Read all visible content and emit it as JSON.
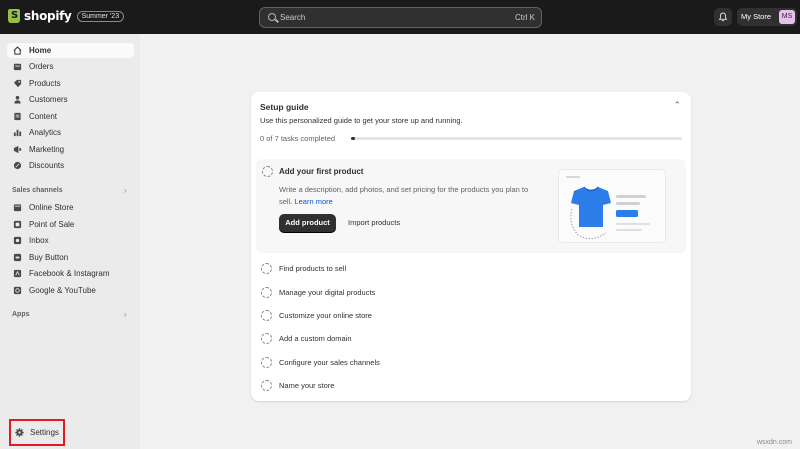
{
  "topbar": {
    "brand": "shopify",
    "edition": "Summer '23",
    "search_placeholder": "Search",
    "search_shortcut": "Ctrl K",
    "store_name": "My Store",
    "avatar_initials": "MS"
  },
  "sidebar": {
    "main_items": [
      {
        "label": "Home",
        "icon": "home-icon",
        "active": true
      },
      {
        "label": "Orders",
        "icon": "orders-icon"
      },
      {
        "label": "Products",
        "icon": "products-icon"
      },
      {
        "label": "Customers",
        "icon": "customers-icon"
      },
      {
        "label": "Content",
        "icon": "content-icon"
      },
      {
        "label": "Analytics",
        "icon": "analytics-icon"
      },
      {
        "label": "Marketing",
        "icon": "marketing-icon"
      },
      {
        "label": "Discounts",
        "icon": "discounts-icon"
      }
    ],
    "sales_channels_label": "Sales channels",
    "sales_channels": [
      {
        "label": "Online Store",
        "icon": "online-store-icon"
      },
      {
        "label": "Point of Sale",
        "icon": "point-of-sale-icon"
      },
      {
        "label": "Inbox",
        "icon": "inbox-icon"
      },
      {
        "label": "Buy Button",
        "icon": "buy-button-icon"
      },
      {
        "label": "Facebook & Instagram",
        "icon": "facebook-instagram-icon"
      },
      {
        "label": "Google & YouTube",
        "icon": "google-youtube-icon"
      }
    ],
    "apps_label": "Apps",
    "settings_label": "Settings"
  },
  "setup_guide": {
    "title": "Setup guide",
    "subtitle": "Use this personalized guide to get your store up and running.",
    "progress_text": "0 of 7 tasks completed",
    "progress_fraction": 0.0,
    "open_task": {
      "title": "Add your first product",
      "description": "Write a description, add photos, and set pricing for the products you plan to sell.",
      "learn_more": "Learn more",
      "primary_button": "Add product",
      "secondary_button": "Import products"
    },
    "tasks": [
      "Find products to sell",
      "Manage your digital products",
      "Customize your online store",
      "Add a custom domain",
      "Configure your sales channels",
      "Name your store"
    ]
  },
  "watermark": "wsxdn.com",
  "colors": {
    "topbar": "#1a1a1a",
    "sidebar": "#ebebeb",
    "highlight_border": "#e01b24",
    "link": "#005bd3",
    "shirt": "#2b7de9"
  }
}
